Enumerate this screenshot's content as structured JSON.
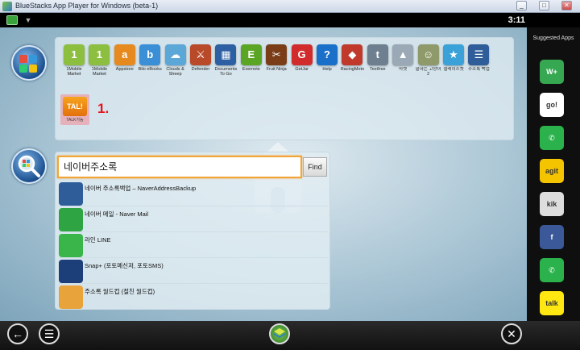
{
  "window": {
    "title": "BlueStacks App Player for Windows (beta-1)",
    "buttons": [
      "_",
      "□",
      "✕"
    ]
  },
  "status_bar": {
    "time": "3:11"
  },
  "apps": [
    {
      "label": "1Mobile Market",
      "icon": "1mobile-icon",
      "glyph": "1",
      "color": "#8cbf3f"
    },
    {
      "label": "1Mobile Market",
      "icon": "1mobile-icon",
      "glyph": "1",
      "color": "#8cbf3f"
    },
    {
      "label": "Appstore",
      "icon": "amazon-appstore-icon",
      "glyph": "a",
      "color": "#e68a1f"
    },
    {
      "label": "Bilo eBooks",
      "icon": "ebooks-icon",
      "glyph": "b",
      "color": "#3a8fd6"
    },
    {
      "label": "Clouds & Sheep",
      "icon": "clouds-sheep-icon",
      "glyph": "☁",
      "color": "#5aa7d8"
    },
    {
      "label": "Defender",
      "icon": "defender-icon",
      "glyph": "⚔",
      "color": "#b84a2a"
    },
    {
      "label": "Documents To Go",
      "icon": "documents-icon",
      "glyph": "▦",
      "color": "#2d5fa3"
    },
    {
      "label": "Evernote",
      "icon": "evernote-icon",
      "glyph": "E",
      "color": "#5ba525"
    },
    {
      "label": "Fruit Ninja",
      "icon": "fruit-ninja-icon",
      "glyph": "✂",
      "color": "#7a3d18"
    },
    {
      "label": "GetJar",
      "icon": "getjar-icon",
      "glyph": "G",
      "color": "#d22b2b"
    },
    {
      "label": "Help",
      "icon": "help-icon",
      "glyph": "?",
      "color": "#1a6fc9"
    },
    {
      "label": "RacingMoto",
      "icon": "racing-moto-icon",
      "glyph": "◆",
      "color": "#c0392b"
    },
    {
      "label": "Textfree",
      "icon": "textfree-icon",
      "glyph": "t",
      "color": "#6e7f8f"
    },
    {
      "label": "마켓",
      "icon": "market-icon",
      "glyph": "▲",
      "color": "#9aa9b5"
    },
    {
      "label": "말하는 고양이 2",
      "icon": "talking-cat-icon",
      "glyph": "☺",
      "color": "#8f9a6a"
    },
    {
      "label": "설레이스켓",
      "icon": "star-app-icon",
      "glyph": "★",
      "color": "#3aa2d8"
    },
    {
      "label": "주소록 백업",
      "icon": "contact-backup-icon",
      "glyph": "☰",
      "color": "#2f5d9a"
    }
  ],
  "installed_app": {
    "glyph": "TAL!",
    "label": "TALK가능"
  },
  "annotation": "1.",
  "search": {
    "query": "네이버주소록",
    "find_label": "Find"
  },
  "results": [
    {
      "label": "네이버 주소록백업 – NaverAddressBackup",
      "icon": "naver-backup-icon",
      "color": "#2f5d9a"
    },
    {
      "label": "네이버 메일 - Naver Mail",
      "icon": "naver-mail-icon",
      "color": "#2ea443"
    },
    {
      "label": "라인 LINE",
      "icon": "line-icon",
      "color": "#39b54a"
    },
    {
      "label": "Snap+ (포토메신저, 포토SMS)",
      "icon": "snap-icon",
      "color": "#1c3f7a"
    },
    {
      "label": "주소록 월드컵 (절친 월드컵)",
      "icon": "world-cup-icon",
      "color": "#e8a33a"
    }
  ],
  "suggested": {
    "header": "Suggested Apps",
    "apps": [
      {
        "icon": "whatsapp-plus-icon",
        "glyph": "W+",
        "color": "#36a852"
      },
      {
        "icon": "gochat-icon",
        "glyph": "go!",
        "color": "#ffffff"
      },
      {
        "icon": "whatsapp-icon",
        "glyph": "✆",
        "color": "#2bb24c"
      },
      {
        "icon": "agit-icon",
        "glyph": "agit",
        "color": "#f5c400"
      },
      {
        "icon": "kik-icon",
        "glyph": "kik",
        "color": "#dddddd"
      },
      {
        "icon": "facebook-icon",
        "glyph": "f",
        "color": "#3b5998"
      },
      {
        "icon": "whatsapp-icon-2",
        "glyph": "✆",
        "color": "#2bb24c"
      },
      {
        "icon": "kakaotalk-icon",
        "glyph": "talk",
        "color": "#ffe812"
      }
    ]
  },
  "nav": {
    "back": "←",
    "menu": "☰",
    "settings": "✕"
  }
}
